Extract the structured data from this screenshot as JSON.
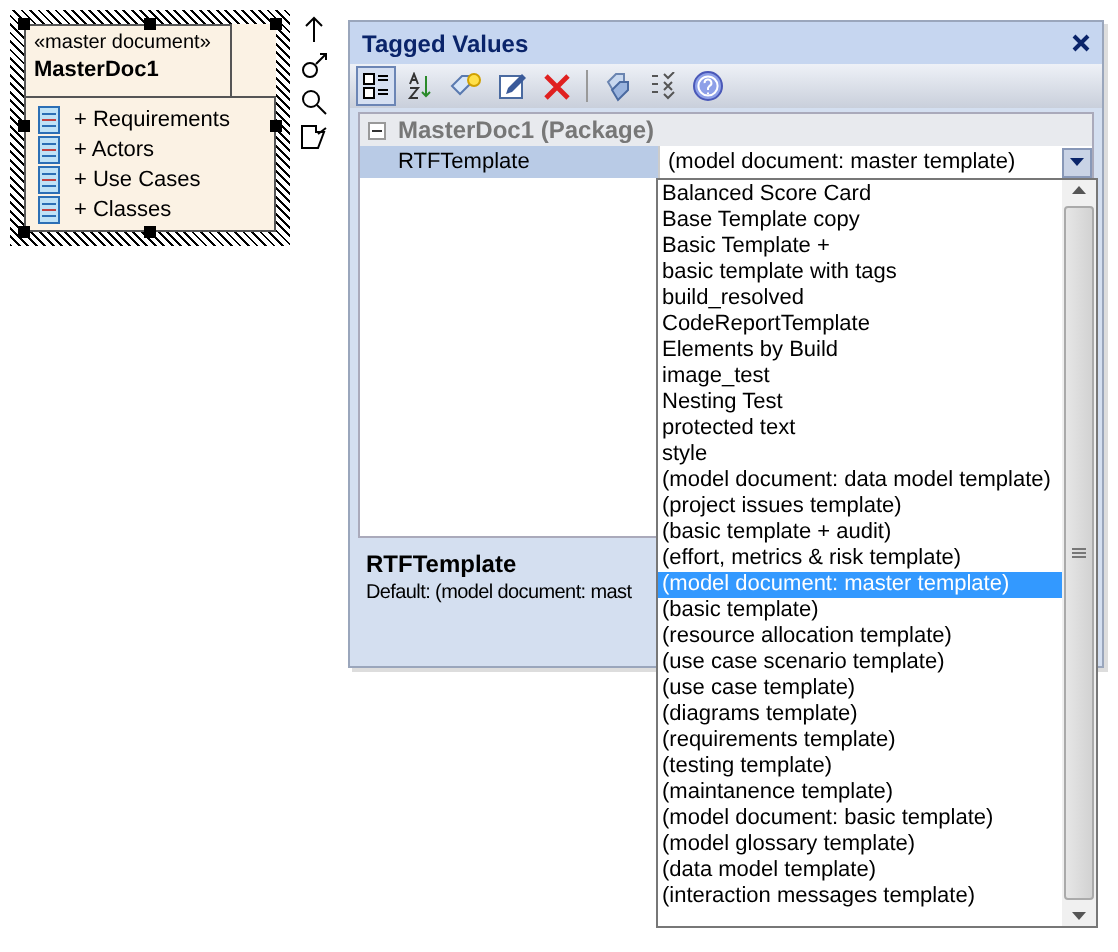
{
  "diagram_element": {
    "stereotype": "«master document»",
    "name": "MasterDoc1",
    "selected": true,
    "items": [
      {
        "label": "+ Requirements"
      },
      {
        "label": "+ Actors"
      },
      {
        "label": "+ Use Cases"
      },
      {
        "label": "+ Classes"
      }
    ]
  },
  "panel": {
    "title": "Tagged Values",
    "group": {
      "name": "MasterDoc1 (Package)",
      "expanded": true
    },
    "property": {
      "name": "RTFTemplate",
      "value": "(model document: master template)",
      "selected": true
    },
    "dropdown": {
      "options": [
        {
          "label": "Balanced Score Card",
          "selected": false
        },
        {
          "label": "Base Template copy",
          "selected": false
        },
        {
          "label": "Basic Template +",
          "selected": false
        },
        {
          "label": "basic template with tags",
          "selected": false
        },
        {
          "label": "build_resolved",
          "selected": false
        },
        {
          "label": "CodeReportTemplate",
          "selected": false
        },
        {
          "label": "Elements by Build",
          "selected": false
        },
        {
          "label": "image_test",
          "selected": false
        },
        {
          "label": "Nesting Test",
          "selected": false
        },
        {
          "label": "protected text",
          "selected": false
        },
        {
          "label": "style",
          "selected": false
        },
        {
          "label": "(model document: data model template)",
          "selected": false
        },
        {
          "label": "(project issues template)",
          "selected": false
        },
        {
          "label": "(basic template + audit)",
          "selected": false
        },
        {
          "label": "(effort, metrics & risk template)",
          "selected": false
        },
        {
          "label": "(model document: master template)",
          "selected": true
        },
        {
          "label": "(basic template)",
          "selected": false
        },
        {
          "label": "(resource allocation template)",
          "selected": false
        },
        {
          "label": "(use case scenario template)",
          "selected": false
        },
        {
          "label": "(use case template)",
          "selected": false
        },
        {
          "label": "(diagrams template)",
          "selected": false
        },
        {
          "label": "(requirements template)",
          "selected": false
        },
        {
          "label": "(testing template)",
          "selected": false
        },
        {
          "label": "(maintanence template)",
          "selected": false
        },
        {
          "label": "(model document: basic template)",
          "selected": false
        },
        {
          "label": "(model glossary template)",
          "selected": false
        },
        {
          "label": "(data model template)",
          "selected": false
        },
        {
          "label": "(interaction messages template)",
          "selected": false
        }
      ]
    },
    "description": {
      "title": "RTFTemplate",
      "text": "Default: (model document: mast"
    }
  }
}
